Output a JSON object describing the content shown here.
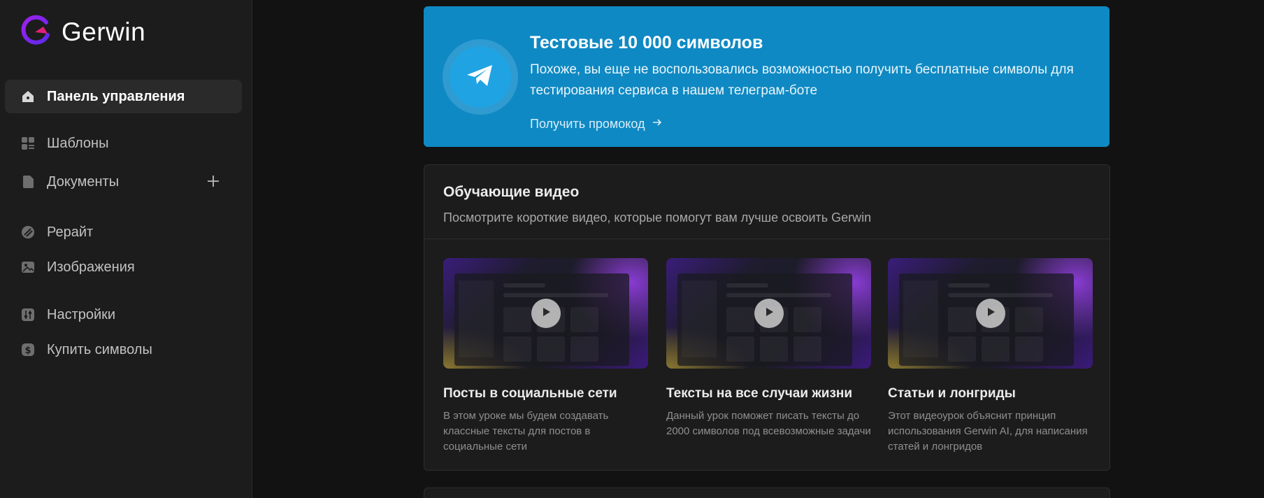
{
  "brand": {
    "name": "Gerwin",
    "logo_icon": "gerwin-logo-icon",
    "accent": "#7b2ff2"
  },
  "sidebar": {
    "items": [
      {
        "label": "Панель управления",
        "icon": "home-icon",
        "active": true
      },
      {
        "label": "Шаблоны",
        "icon": "grid-icon",
        "active": false
      },
      {
        "label": "Документы",
        "icon": "document-icon",
        "active": false
      },
      {
        "label": "Рерайт",
        "icon": "rewrite-icon",
        "active": false
      },
      {
        "label": "Изображения",
        "icon": "image-icon",
        "active": false
      },
      {
        "label": "Настройки",
        "icon": "settings-icon",
        "active": false
      },
      {
        "label": "Купить символы",
        "icon": "dollar-icon",
        "active": false
      }
    ],
    "add_icon": "plus-icon"
  },
  "promo": {
    "title": "Тестовые 10 000 символов",
    "text": "Похоже, вы еще не воспользовались возможностью получить бесплатные символы для тестирования сервиса в нашем телеграм-боте",
    "link_label": "Получить промокод",
    "icon": "telegram-icon",
    "link_icon": "arrow-right-icon",
    "color": "#0f89c3"
  },
  "videos": {
    "title": "Обучающие видео",
    "subtitle": "Посмотрите короткие видео, которые помогут вам лучше освоить Gerwin",
    "cards": [
      {
        "title": "Посты в социальные сети",
        "desc": "В этом уроке мы будем создавать классные тексты для постов в социальные сети"
      },
      {
        "title": "Тексты на все случаи жизни",
        "desc": "Данный урок поможет писать тексты до 2000 символов под всевозможные задачи"
      },
      {
        "title": "Статьи и лонгриды",
        "desc": "Этот видеоурок объяснит принцип использования Gerwin AI, для написания статей и лонгридов"
      }
    ]
  }
}
